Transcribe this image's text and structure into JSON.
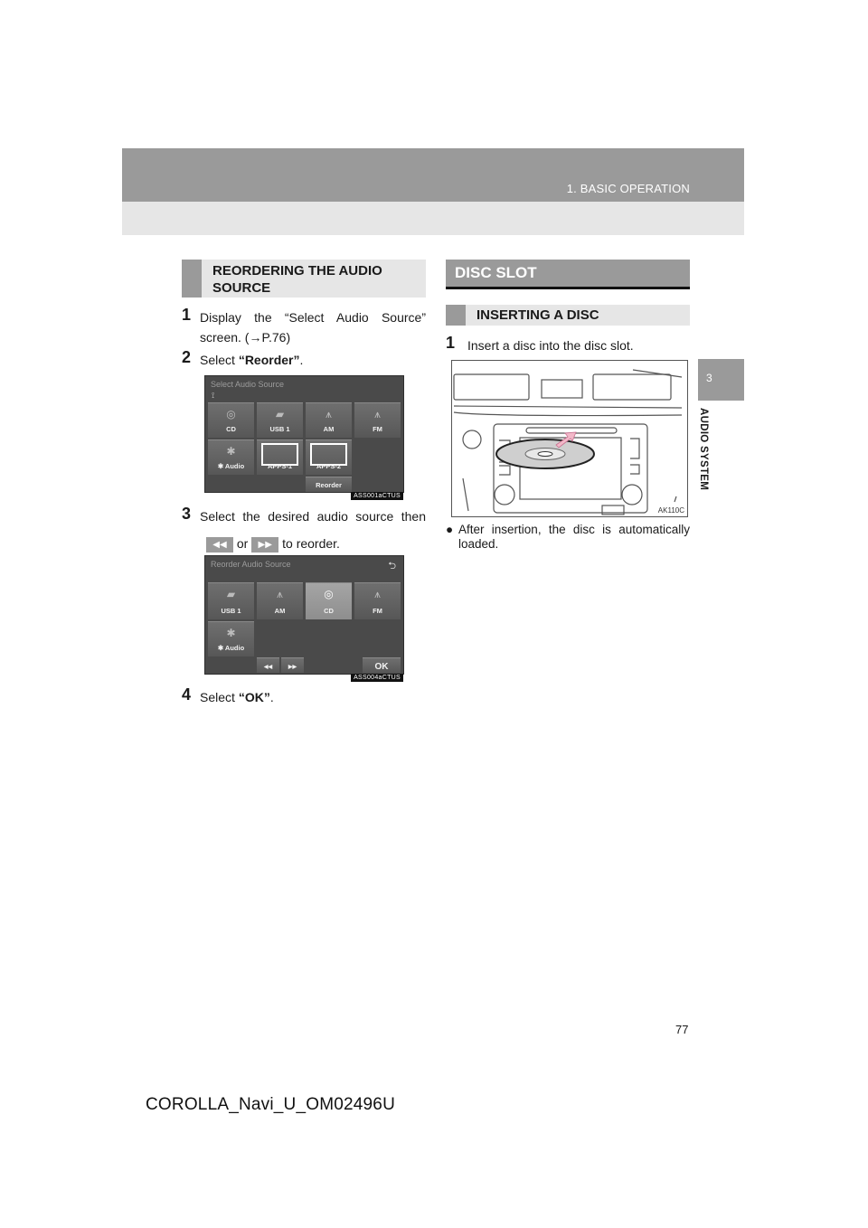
{
  "header": {
    "section_title": "1. BASIC OPERATION"
  },
  "side_tab": {
    "chapter_number": "3",
    "chapter_label": "AUDIO SYSTEM"
  },
  "left": {
    "heading_line1": "REORDERING THE AUDIO",
    "heading_line2": "SOURCE",
    "steps": [
      {
        "num": "1",
        "line1": "Display the “Select Audio Source”",
        "line2": "screen. (→P.76)"
      },
      {
        "num": "2",
        "prefix": "Select ",
        "bold": "“Reorder”",
        "suffix": "."
      },
      {
        "num": "3",
        "line1": "Select the desired audio source then",
        "or": "or",
        "suffix": "to reorder.",
        "rewind_glyph": "◀◀",
        "forward_glyph": "▶▶"
      },
      {
        "num": "4",
        "prefix": "Select ",
        "bold": "“OK”",
        "suffix": "."
      }
    ],
    "screen1": {
      "title": "Select Audio Source",
      "tiles": [
        {
          "label": "CD",
          "icon": "disc-icon",
          "glyph": "◎"
        },
        {
          "label": "USB 1",
          "icon": "usb-icon",
          "glyph": "▰"
        },
        {
          "label": "AM",
          "icon": "antenna-icon",
          "glyph": "⩚"
        },
        {
          "label": "FM",
          "icon": "antenna-icon",
          "glyph": "⩚"
        },
        {
          "label": "✱ Audio",
          "icon": "bluetooth-icon",
          "glyph": "✱"
        },
        {
          "label": "APPS-1",
          "icon": "app-placeholder-icon",
          "glyph": ""
        },
        {
          "label": "APPS-2",
          "icon": "app-placeholder-icon",
          "glyph": ""
        }
      ],
      "reorder_label": "Reorder",
      "code": "ASS001aCTUS"
    },
    "screen2": {
      "title": "Reorder Audio Source",
      "tiles": [
        {
          "label": "USB 1",
          "glyph": "▰"
        },
        {
          "label": "AM",
          "glyph": "⩚"
        },
        {
          "label": "CD",
          "glyph": "◎",
          "selected": true
        },
        {
          "label": "FM",
          "glyph": "⩚"
        },
        {
          "label": "✱ Audio",
          "glyph": "✱"
        }
      ],
      "back_glyph": "⮌",
      "rewind_glyph": "◀◀",
      "forward_glyph": "▶▶",
      "ok_label": "OK",
      "code": "ASS004aCTUS"
    }
  },
  "right": {
    "section_heading": "DISC SLOT",
    "subheading": "INSERTING A DISC",
    "step1": {
      "num": "1",
      "text": "Insert a disc into the disc slot."
    },
    "illustration_code": "AK110C",
    "note": "After insertion, the disc is automatically loaded."
  },
  "page_number": "77",
  "footer": "COROLLA_Navi_U_OM02496U"
}
